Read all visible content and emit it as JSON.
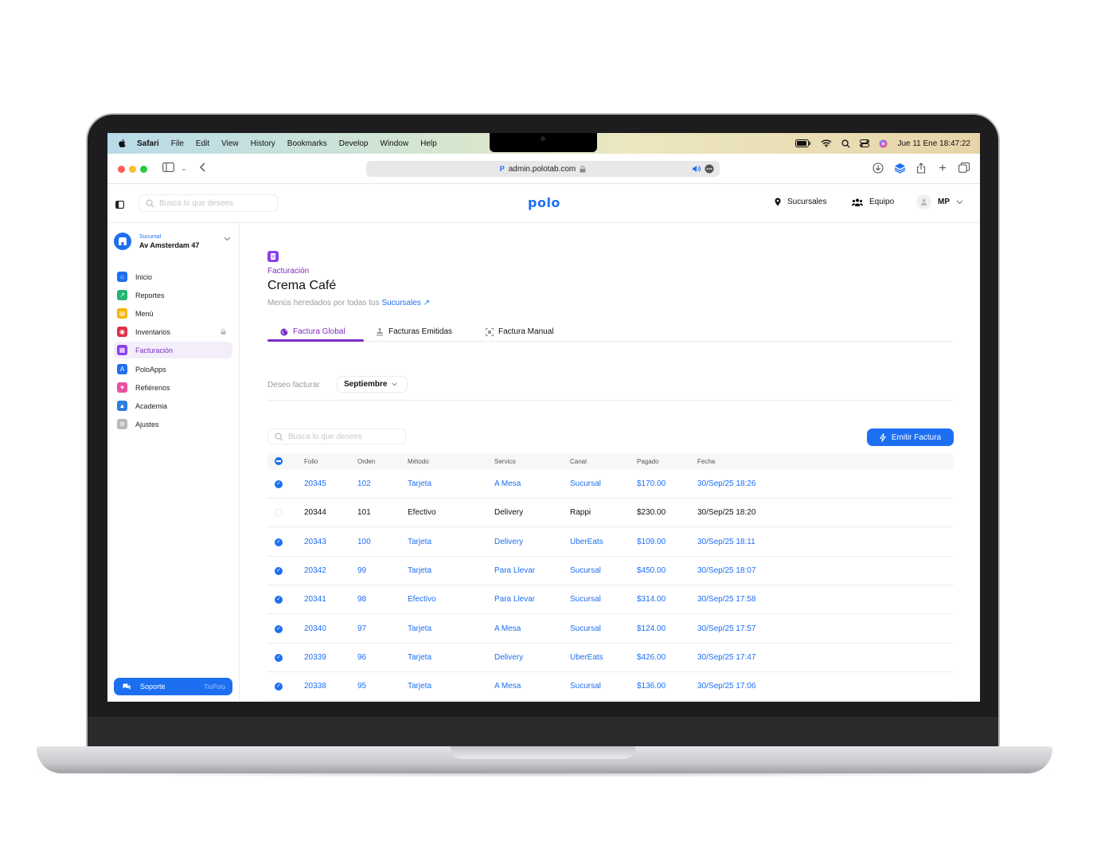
{
  "menubar": {
    "items": [
      "Safari",
      "File",
      "Edit",
      "View",
      "History",
      "Bookmarks",
      "Develop",
      "Window",
      "Help"
    ],
    "clock": "Jue 11 Ene  18:47:22"
  },
  "browser": {
    "url": "admin.polotab.com",
    "favicon": "P"
  },
  "header": {
    "search_placeholder": "Busca lo que desees",
    "logo": "polo",
    "branches": "Sucursales",
    "team": "Equipo",
    "user_initials": "MP"
  },
  "sidebar": {
    "branch_label": "Sucursal",
    "branch_name": "Av Amsterdam 47",
    "items": [
      {
        "label": "Inicio",
        "icon": "home-icon",
        "color": "#1d6ff2"
      },
      {
        "label": "Reportes",
        "icon": "trend-icon",
        "color": "#22b573"
      },
      {
        "label": "Menú",
        "icon": "book-icon",
        "color": "#f7b500"
      },
      {
        "label": "Inventarios",
        "icon": "box-icon",
        "color": "#e0304a"
      },
      {
        "label": "Facturación",
        "icon": "invoice-icon",
        "color": "#8a3ff0"
      },
      {
        "label": "PoloApps",
        "icon": "apps-icon",
        "color": "#1d6ff2"
      },
      {
        "label": "Refiérenos",
        "icon": "heart-icon",
        "color": "#ec4fa0"
      },
      {
        "label": "Academia",
        "icon": "cap-icon",
        "color": "#2d7de0"
      },
      {
        "label": "Ajustes",
        "icon": "gear-icon",
        "color": "#b8b8b8"
      }
    ],
    "support": "Soporte",
    "support_alias": "TioPolo"
  },
  "main": {
    "section": "Facturación",
    "title": "Crema Café",
    "subtitle": "Menús heredados por todas tus",
    "subtitle_link": "Sucursales",
    "tabs": [
      "Factura Global",
      "Facturas Emitidas",
      "Factura Manual"
    ],
    "filter_label": "Deseo facturar",
    "month": "Septiembre",
    "table_search_placeholder": "Busca lo que desees",
    "emit_button": "Emitir Factura"
  },
  "table": {
    "headers": [
      "Folio",
      "Orden",
      "Método",
      "Servico",
      "Canal",
      "Pagado",
      "Fecha"
    ],
    "rows": [
      {
        "selected": true,
        "folio": "20345",
        "orden": "102",
        "metodo": "Tarjeta",
        "servicio": "A Mesa",
        "canal": "Sucursal",
        "pagado": "$170.00",
        "fecha": "30/Sep/25 18:26"
      },
      {
        "selected": false,
        "folio": "20344",
        "orden": "101",
        "metodo": "Efectivo",
        "servicio": "Delivery",
        "canal": "Rappi",
        "pagado": "$230.00",
        "fecha": "30/Sep/25 18:20"
      },
      {
        "selected": true,
        "folio": "20343",
        "orden": "100",
        "metodo": "Tarjeta",
        "servicio": "Delivery",
        "canal": "UberEats",
        "pagado": "$109.00",
        "fecha": "30/Sep/25 18:11"
      },
      {
        "selected": true,
        "folio": "20342",
        "orden": "99",
        "metodo": "Tarjeta",
        "servicio": "Para Llevar",
        "canal": "Sucursal",
        "pagado": "$450.00",
        "fecha": "30/Sep/25 18:07"
      },
      {
        "selected": true,
        "folio": "20341",
        "orden": "98",
        "metodo": "Efectivo",
        "servicio": "Para Llevar",
        "canal": "Sucursal",
        "pagado": "$314.00",
        "fecha": "30/Sep/25 17:58"
      },
      {
        "selected": true,
        "folio": "20340",
        "orden": "97",
        "metodo": "Tarjeta",
        "servicio": "A Mesa",
        "canal": "Sucursal",
        "pagado": "$124.00",
        "fecha": "30/Sep/25 17:57"
      },
      {
        "selected": true,
        "folio": "20339",
        "orden": "96",
        "metodo": "Tarjeta",
        "servicio": "Delivery",
        "canal": "UberEats",
        "pagado": "$426.00",
        "fecha": "30/Sep/25 17:47"
      },
      {
        "selected": true,
        "folio": "20338",
        "orden": "95",
        "metodo": "Tarjeta",
        "servicio": "A Mesa",
        "canal": "Sucursal",
        "pagado": "$136.00",
        "fecha": "30/Sep/25 17:06"
      }
    ]
  }
}
